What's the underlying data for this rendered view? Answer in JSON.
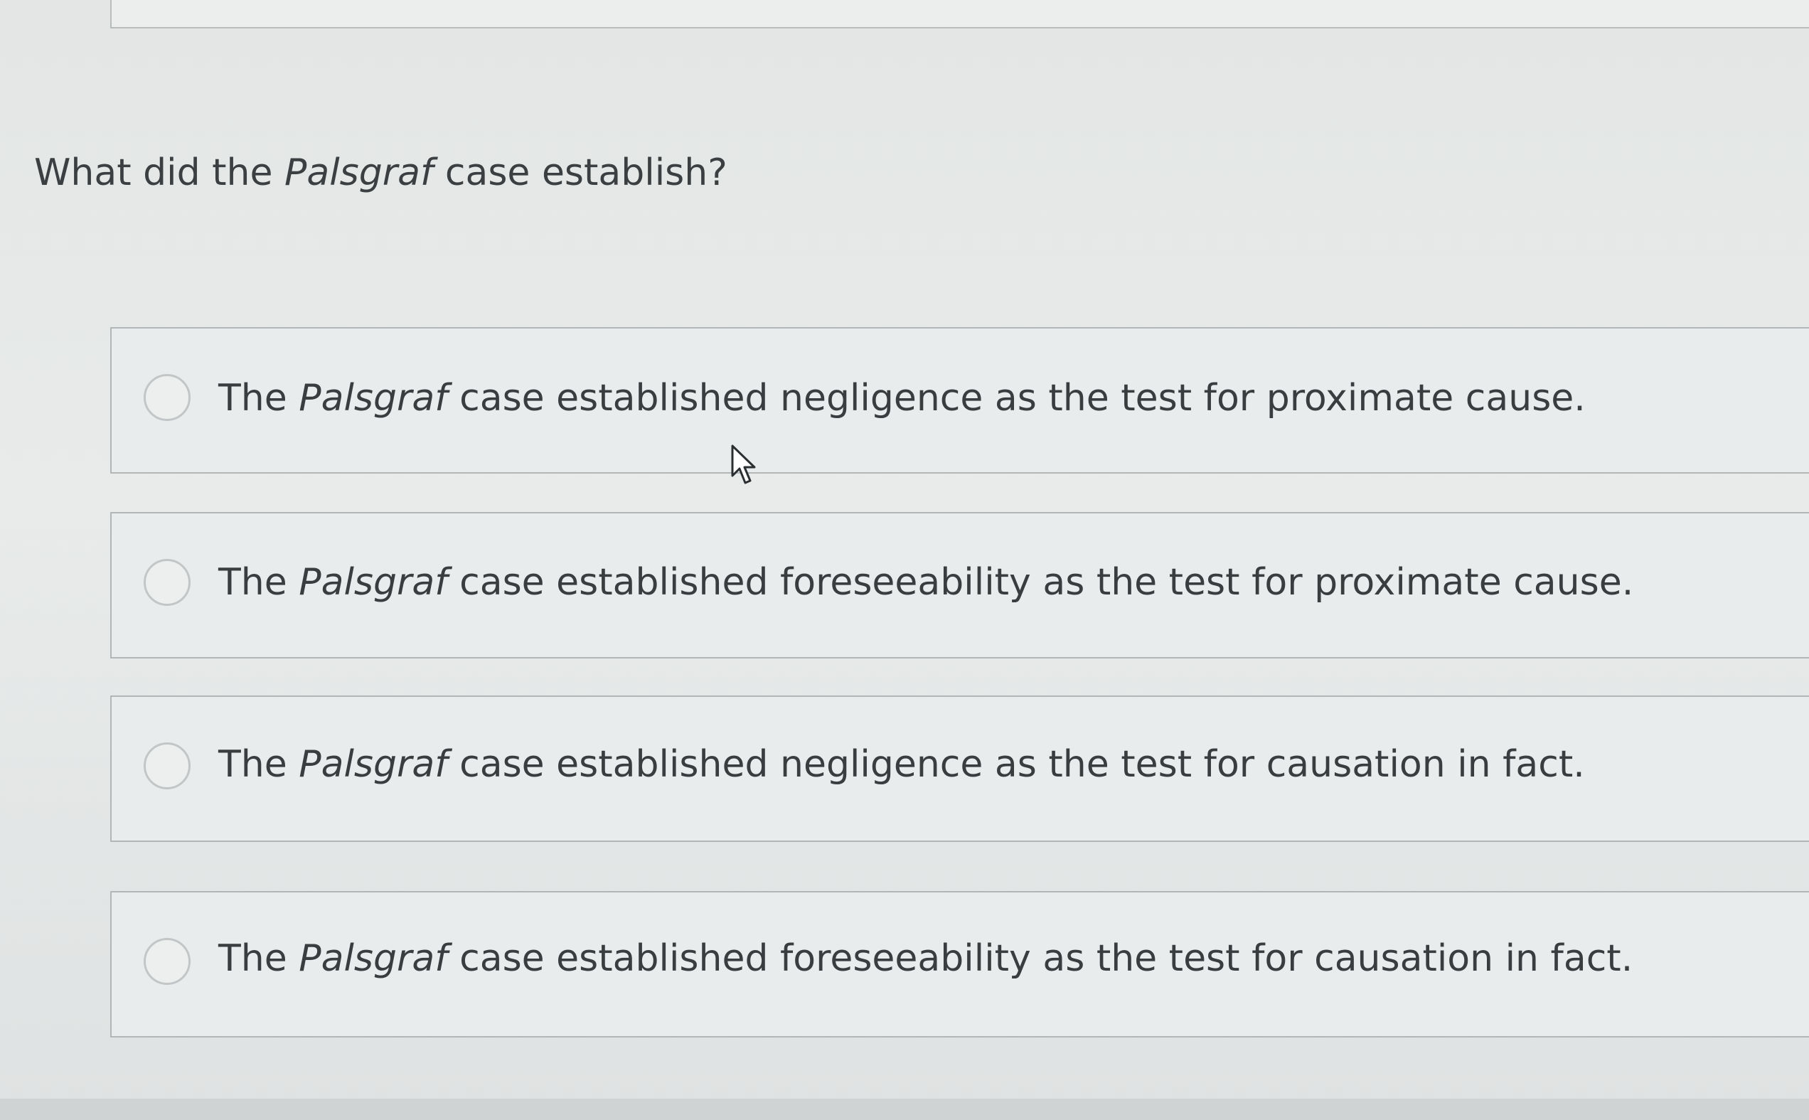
{
  "question": {
    "prefix": "What did the ",
    "case_name": "Palsgraf",
    "suffix": " case establish?"
  },
  "options": [
    {
      "prefix": "The ",
      "case_name": "Palsgraf",
      "suffix": " case established negligence as the test for proximate cause.",
      "selected": false
    },
    {
      "prefix": "The ",
      "case_name": "Palsgraf",
      "suffix": " case established foreseeability as the test for proximate cause.",
      "selected": false
    },
    {
      "prefix": "The ",
      "case_name": "Palsgraf",
      "suffix": " case established negligence as the test for causation in fact.",
      "selected": false
    },
    {
      "prefix": "The ",
      "case_name": "Palsgraf",
      "suffix": " case established foreseeability as the test for causation in fact.",
      "selected": false
    }
  ],
  "icons": {
    "radio": "radio-unchecked-icon",
    "cursor": "mouse-pointer-icon"
  },
  "colors": {
    "text": "#3a3d40",
    "border": "#b2b6b7",
    "background": "#e6e9e8"
  }
}
